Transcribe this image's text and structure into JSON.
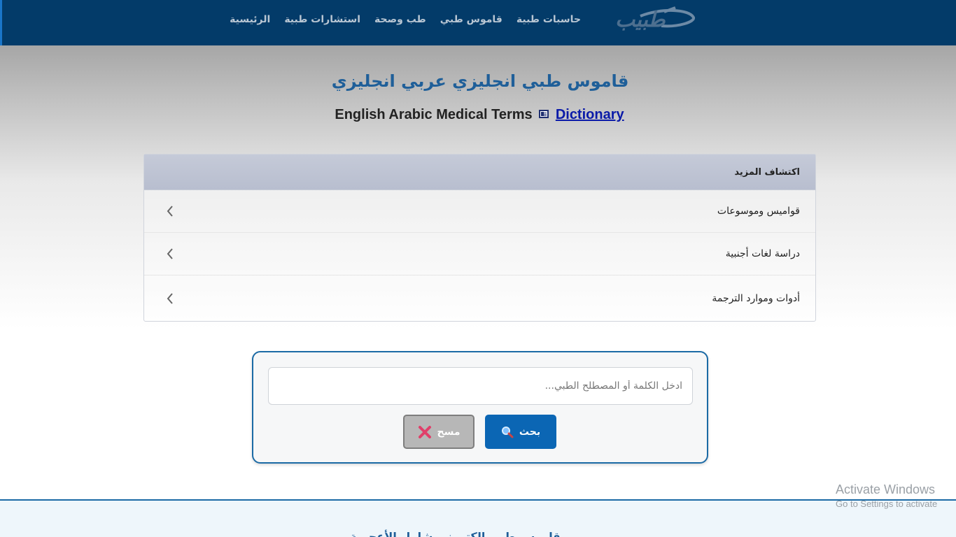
{
  "nav": {
    "logo_text": "طبيب",
    "links": [
      "الرئيسية",
      "استشارات طبية",
      "طب وصحة",
      "قاموس طبي",
      "حاسبات طبية"
    ]
  },
  "header": {
    "title": "قاموس طبي انجليزي عربي انجليزي",
    "subtitle_text": "English Arabic Medical Terms",
    "subtitle_link": "Dictionary"
  },
  "explore": {
    "heading": "اكتشاف المزيد",
    "items": [
      "قواميس وموسوعات",
      "دراسة لغات أجنبية",
      "أدوات وموارد الترجمة"
    ]
  },
  "search": {
    "placeholder": "ادخل الكلمة أو المصطلح الطبي...",
    "search_label": "بحث",
    "clear_label": "مسح"
  },
  "footer": {
    "partial_text": "قاموس طبي الكتروني شامل الأعجمية"
  },
  "watermark": {
    "line1": "Activate Windows",
    "line2": "Go to Settings to activate"
  },
  "colors": {
    "navbar": "#033b69",
    "title": "#1f5f99",
    "search_button": "#0b66b4",
    "clear_button": "#b7b7b7",
    "box_border": "#1b6aa5"
  }
}
